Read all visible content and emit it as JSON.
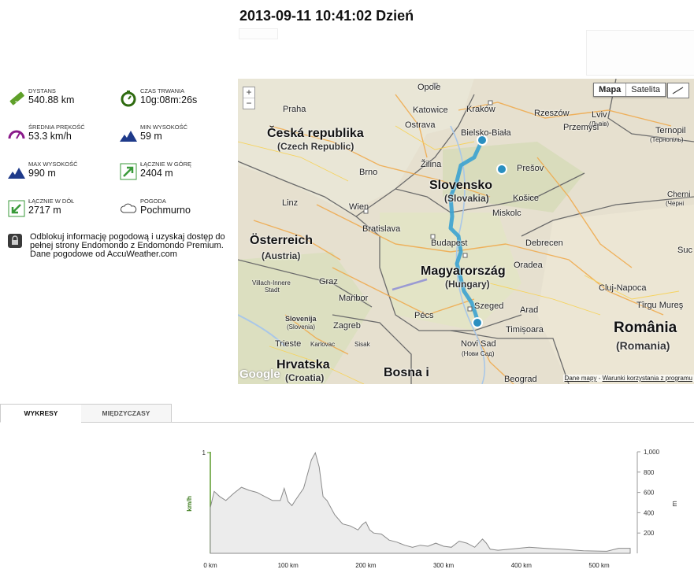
{
  "title": "2013-09-11 10:41:02 Dzień",
  "stats": [
    {
      "id": "distance",
      "label": "DYSTANS",
      "value": "540.88 km",
      "icon": "ruler-icon"
    },
    {
      "id": "duration",
      "label": "CZAS TRWANIA",
      "value": "10g:08m:26s",
      "icon": "stopwatch-icon"
    },
    {
      "id": "avg_speed",
      "label": "ŚREDNIA PRĘKOŚĆ",
      "value": "53.3 km/h",
      "icon": "speedometer-icon"
    },
    {
      "id": "min_alt",
      "label": "MIN WYSOKOŚĆ",
      "value": "59 m",
      "icon": "mountain-icon"
    },
    {
      "id": "max_alt",
      "label": "MAX WYSOKOŚĆ",
      "value": "990 m",
      "icon": "mountain-icon"
    },
    {
      "id": "total_up",
      "label": "ŁĄCZNIE W GÓRĘ",
      "value": "2404 m",
      "icon": "arrow-up-right-icon"
    },
    {
      "id": "total_down",
      "label": "ŁĄCZNIE W DÓŁ",
      "value": "2717 m",
      "icon": "arrow-down-left-icon"
    },
    {
      "id": "weather",
      "label": "POGODA",
      "value": "Pochmurno",
      "icon": "cloud-icon"
    }
  ],
  "notice": {
    "line1": "Odblokuj informację pogodową i uzyskaj dostęp do pełnej strony Endomondo z Endomondo Premium.",
    "line2": "Dane pogodowe od AccuWeather.com"
  },
  "map": {
    "type_buttons": [
      "Mapa",
      "Satelita"
    ],
    "zoom_in": "+",
    "zoom_out": "−",
    "logo": "Google",
    "attribution": {
      "data": "Dane mapy",
      "sep": " - ",
      "terms": "Warunki korzystania z programu"
    },
    "labels": {
      "opole": "Opole",
      "katowice": "Katowice",
      "krakow": "Kraków",
      "rzeszow": "Rzeszów",
      "lviv": "Lviv",
      "lviv2": "(Львів)",
      "praha": "Praha",
      "czech": "Česká republika",
      "czech2": "(Czech Republic)",
      "ostrava": "Ostrava",
      "bielsko": "Bielsko-Biała",
      "przemysl": "Przemyśl",
      "ternopil": "Ternopil",
      "ternopil2": "(Тернопіль)",
      "zilina": "Žilina",
      "presov": "Prešov",
      "brno": "Brno",
      "slovensko": "Slovensko",
      "slovakia": "(Slovakia)",
      "kosice": "Košice",
      "cherni": "Cherni",
      "cherni2": "(Черні",
      "linz": "Linz",
      "wien": "Wien",
      "bratislava": "Bratislava",
      "miskolc": "Miskolc",
      "osterreich": "Österreich",
      "austria": "(Austria)",
      "budapest": "Budapest",
      "debrecen": "Debrecen",
      "oradea": "Oradea",
      "suc": "Suc",
      "magyar": "Magyarország",
      "hungary": "(Hungary)",
      "villach": "Villach-Innere",
      "stadt": "Stadt",
      "graz": "Graz",
      "cluj": "Cluj-Napoca",
      "maribor": "Maribor",
      "szeged": "Szeged",
      "tirgu": "Tîrgu Mureş",
      "slovenija": "Slovenija",
      "slovenia": "(Slovenia)",
      "zagreb": "Zagreb",
      "pecs": "Pécs",
      "arad": "Arad",
      "romania": "România",
      "romania2": "(Romania)",
      "timisoara": "Timișoara",
      "trieste": "Trieste",
      "karlovac": "Karlovac",
      "sisak": "Sisak",
      "novisad": "Novi Sad",
      "novisad2": "(Нови Сад)",
      "hrvatska": "Hrvatska",
      "croatia": "(Croatia)",
      "bosna": "Bosna i",
      "beograd": "Beograd"
    }
  },
  "tabs": [
    "WYKRESY",
    "MIĘDZYCZASY"
  ],
  "chart_data": {
    "type": "area",
    "xlabel": "",
    "ylabel_left": "km/h",
    "ylabel_right": "m",
    "x_ticks": [
      "0 km",
      "100 km",
      "200 km",
      "300 km",
      "400 km",
      "500 km"
    ],
    "y_left_ticks": [
      "1"
    ],
    "y_right_ticks": [
      "1,000",
      "800",
      "600",
      "400",
      "200"
    ],
    "xlim": [
      0,
      540
    ],
    "ylim_right": [
      0,
      1000
    ],
    "series": [
      {
        "x": [
          0,
          5,
          12,
          20,
          30,
          40,
          50,
          60,
          70,
          80,
          90,
          95,
          100,
          105,
          110,
          120,
          125,
          130,
          135,
          140,
          145,
          150,
          160,
          170,
          180,
          190,
          195,
          200,
          205,
          210,
          220,
          230,
          240,
          250,
          260,
          270,
          280,
          290,
          300,
          310,
          320,
          330,
          340,
          350,
          355,
          360,
          370,
          390,
          410,
          430,
          450,
          480,
          510,
          525,
          540
        ],
        "y": [
          450,
          610,
          560,
          520,
          590,
          650,
          620,
          600,
          560,
          520,
          520,
          640,
          510,
          470,
          530,
          640,
          780,
          920,
          990,
          850,
          560,
          520,
          380,
          290,
          270,
          230,
          280,
          310,
          230,
          200,
          190,
          130,
          110,
          80,
          60,
          80,
          70,
          100,
          70,
          60,
          120,
          100,
          60,
          140,
          100,
          40,
          30,
          45,
          60,
          50,
          40,
          25,
          20,
          50,
          50
        ]
      }
    ]
  }
}
